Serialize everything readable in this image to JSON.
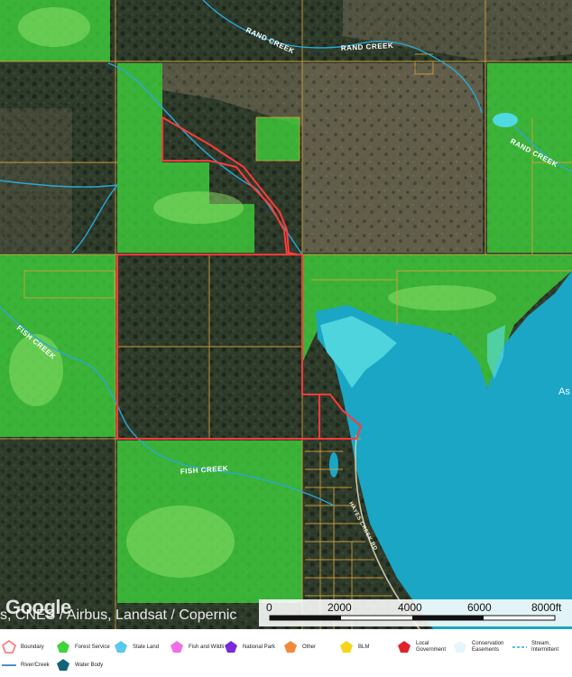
{
  "map": {
    "creek_labels": {
      "rand_creek_1": "RAND CREEK",
      "rand_creek_2": "RAND CREEK",
      "rand_creek_3": "RAND CREEK",
      "fish_creek_1": "FISH CREEK",
      "fish_creek_2": "FISH CREEK"
    },
    "lake_label_partial": "As",
    "road_label": "HAYES CREEK RD",
    "colors": {
      "forest_service": "#3fd33c",
      "water_body": "#1aa6c4",
      "boundary": "#ff3b3b",
      "stream": "#2aa8d8"
    }
  },
  "attribution": {
    "logo": "Google",
    "text": "s, CNES / Airbus, Landsat / Copernic"
  },
  "scale": {
    "ticks": [
      "0",
      "2000",
      "4000",
      "6000",
      "8000ft"
    ]
  },
  "legend": {
    "items": [
      {
        "label": "Boundary",
        "icon": "boundary-icon",
        "color": "#ff6f6f"
      },
      {
        "label": "Forest Service",
        "icon": "forest-service-icon",
        "color": "#3fd33c"
      },
      {
        "label": "State Land",
        "icon": "state-land-icon",
        "color": "#5ac8f0"
      },
      {
        "label": "Fish and Wildli",
        "icon": "fish-wildlife-icon",
        "color": "#f06ee6"
      },
      {
        "label": "National Park",
        "icon": "national-park-icon",
        "color": "#7a2bd6"
      },
      {
        "label": "Other",
        "icon": "other-icon",
        "color": "#f08a3a"
      },
      {
        "label": "BLM",
        "icon": "blm-icon",
        "color": "#f6d61a"
      },
      {
        "label": "Local Government",
        "icon": "local-government-icon",
        "color": "#e0232b"
      },
      {
        "label": "Conservation Easements",
        "icon": "conservation-easements-icon",
        "color": "#e6f6fb"
      },
      {
        "label": "Stream, Intermittent",
        "icon": "stream-intermittent-icon",
        "color": "#2aa8d8"
      },
      {
        "label": "River/Creek",
        "icon": "river-creek-icon",
        "color": "#2a72b8"
      },
      {
        "label": "Water Body",
        "icon": "water-body-icon",
        "color": "#12647a"
      }
    ]
  }
}
